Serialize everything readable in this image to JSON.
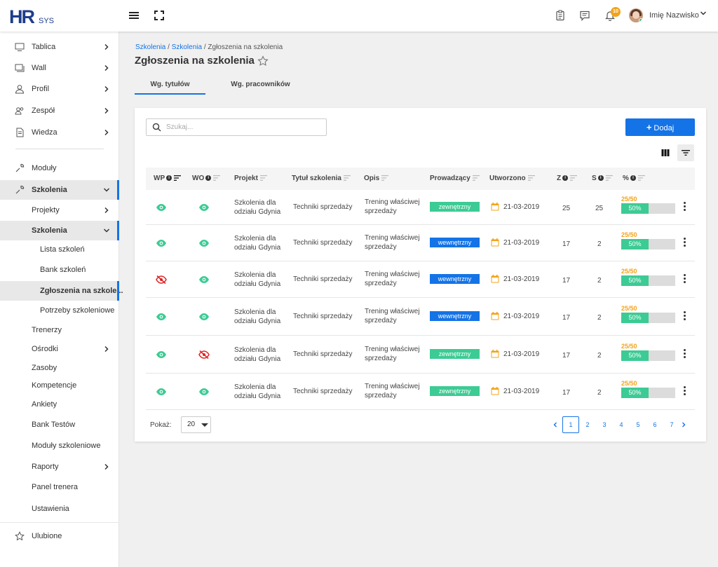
{
  "header": {
    "logo_main": "HR",
    "logo_sub": "SYS",
    "notification_count": "10",
    "user_name": "Imię Nazwisko"
  },
  "sidebar": {
    "items": [
      {
        "label": "Tablica"
      },
      {
        "label": "Wall"
      },
      {
        "label": "Profil"
      },
      {
        "label": "Zespół"
      },
      {
        "label": "Wiedza"
      },
      {
        "label": "Moduły"
      },
      {
        "label": "Szkolenia"
      },
      {
        "label": "Projekty"
      },
      {
        "label": "Szkolenia"
      },
      {
        "label": "Lista szkoleń"
      },
      {
        "label": "Bank szkoleń"
      },
      {
        "label": "Zgłoszenia na szkole..."
      },
      {
        "label": "Potrzeby szkoleniowe"
      },
      {
        "label": "Trenerzy"
      },
      {
        "label": "Ośrodki"
      },
      {
        "label": "Zasoby"
      },
      {
        "label": "Kompetencje"
      },
      {
        "label": "Ankiety"
      },
      {
        "label": "Bank Testów"
      },
      {
        "label": "Moduły szkoleniowe"
      },
      {
        "label": "Raporty"
      },
      {
        "label": "Panel trenera"
      },
      {
        "label": "Ustawienia"
      },
      {
        "label": "Ulubione"
      }
    ]
  },
  "breadcrumb": {
    "link1": "Szkolenia",
    "link2": "Szkolenia",
    "sep": " / ",
    "current": "Zgłoszenia na szkolenia"
  },
  "page": {
    "title": "Zgłoszenia na szkolenia",
    "tabs": [
      {
        "label": "Wg. tytułów"
      },
      {
        "label": "Wg. pracowników"
      }
    ]
  },
  "toolbar": {
    "search_placeholder": "Szukaj...",
    "add_label": "Dodaj"
  },
  "table": {
    "columns": [
      "WP",
      "WO",
      "Projekt",
      "Tytuł szkolenia",
      "Opis",
      "Prowadzący",
      "Utworzono",
      "Z",
      "S",
      "%"
    ],
    "rows": [
      {
        "wp": "visible",
        "wo": "visible",
        "project": [
          "Szkolenia dla",
          "odziału Gdynia"
        ],
        "title": "Techniki sprzedaży",
        "desc": [
          "Trening właściwej",
          "sprzedaży"
        ],
        "leader": "zewnętrzny",
        "leader_type": "ext",
        "created": "21-03-2019",
        "z": "25",
        "s": "25",
        "ratio": "25/50",
        "pct": "50%",
        "pct_value": 0.5
      },
      {
        "wp": "visible",
        "wo": "visible",
        "project": [
          "Szkolenia dla",
          "odziału Gdynia"
        ],
        "title": "Techniki sprzedaży",
        "desc": [
          "Trening właściwej",
          "sprzedaży"
        ],
        "leader": "wewnętrzny",
        "leader_type": "int",
        "created": "21-03-2019",
        "z": "17",
        "s": "2",
        "ratio": "25/50",
        "pct": "50%",
        "pct_value": 0.5
      },
      {
        "wp": "hidden",
        "wo": "visible",
        "project": [
          "Szkolenia dla",
          "odziału Gdynia"
        ],
        "title": "Techniki sprzedaży",
        "desc": [
          "Trening właściwej",
          "sprzedaży"
        ],
        "leader": "wewnętrzny",
        "leader_type": "int",
        "created": "21-03-2019",
        "z": "17",
        "s": "2",
        "ratio": "25/50",
        "pct": "50%",
        "pct_value": 0.5
      },
      {
        "wp": "visible",
        "wo": "visible",
        "project": [
          "Szkolenia dla",
          "odziału Gdynia"
        ],
        "title": "Techniki sprzedaży",
        "desc": [
          "Trening właściwej",
          "sprzedaży"
        ],
        "leader": "wewnętrzny",
        "leader_type": "int",
        "created": "21-03-2019",
        "z": "17",
        "s": "2",
        "ratio": "25/50",
        "pct": "50%",
        "pct_value": 0.5
      },
      {
        "wp": "visible",
        "wo": "hidden",
        "project": [
          "Szkolenia dla",
          "odziału Gdynia"
        ],
        "title": "Techniki sprzedaży",
        "desc": [
          "Trening właściwej",
          "sprzedaży"
        ],
        "leader": "zewnętrzny",
        "leader_type": "ext",
        "created": "21-03-2019",
        "z": "17",
        "s": "2",
        "ratio": "25/50",
        "pct": "50%",
        "pct_value": 0.5
      },
      {
        "wp": "visible",
        "wo": "visible",
        "project": [
          "Szkolenia dla",
          "odziału Gdynia"
        ],
        "title": "Techniki sprzedaży",
        "desc": [
          "Trening właściwej",
          "sprzedaży"
        ],
        "leader": "zewnętrzny",
        "leader_type": "ext",
        "created": "21-03-2019",
        "z": "17",
        "s": "2",
        "ratio": "25/50",
        "pct": "50%",
        "pct_value": 0.5
      }
    ]
  },
  "pagination": {
    "show_label": "Pokaż:",
    "page_size": "20",
    "pages": [
      "1",
      "2",
      "3",
      "4",
      "5",
      "6",
      "7"
    ],
    "current": "1"
  },
  "colors": {
    "accent": "#1473e6",
    "green": "#3ccb94",
    "orange": "#f3a31a",
    "red": "#e02424"
  }
}
